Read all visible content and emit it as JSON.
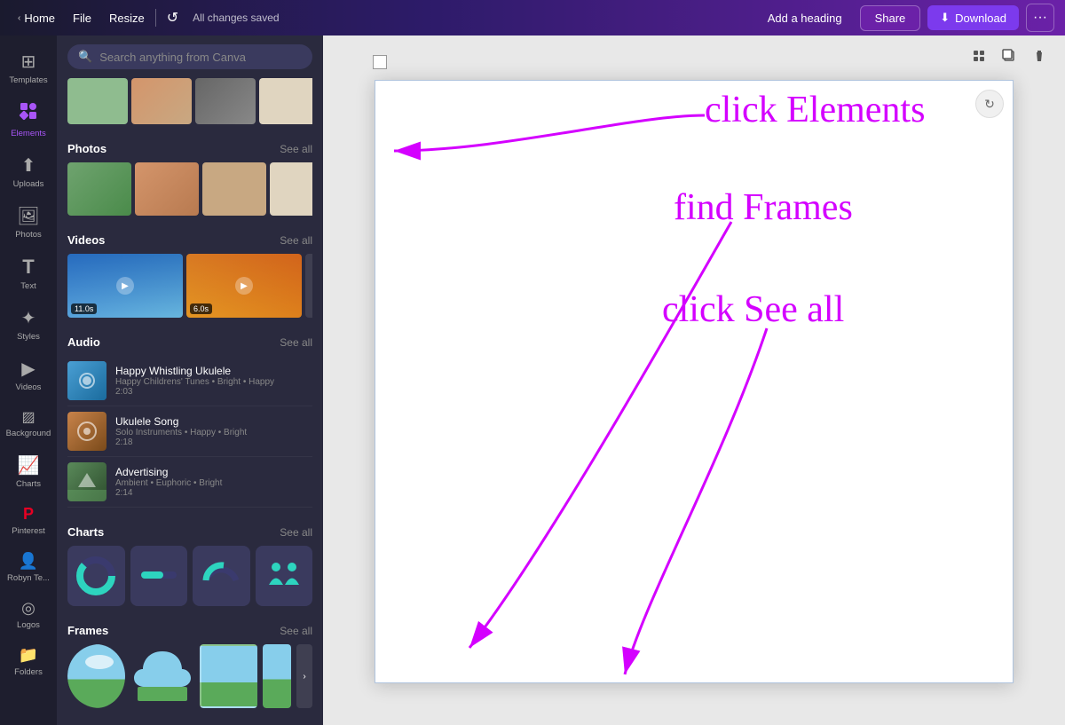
{
  "topbar": {
    "home_label": "Home",
    "file_label": "File",
    "resize_label": "Resize",
    "saved_label": "All changes saved",
    "add_heading_label": "Add a heading",
    "share_label": "Share",
    "download_label": "Download"
  },
  "sidebar": {
    "items": [
      {
        "id": "templates",
        "label": "Templates",
        "icon": "⊞"
      },
      {
        "id": "elements",
        "label": "Elements",
        "icon": "❋"
      },
      {
        "id": "uploads",
        "label": "Uploads",
        "icon": "↑"
      },
      {
        "id": "photos",
        "label": "Photos",
        "icon": "🖼"
      },
      {
        "id": "text",
        "label": "Text",
        "icon": "T"
      },
      {
        "id": "styles",
        "label": "Styles",
        "icon": "✦"
      },
      {
        "id": "videos",
        "label": "Videos",
        "icon": "▶"
      },
      {
        "id": "background",
        "label": "Background",
        "icon": "▨"
      },
      {
        "id": "charts",
        "label": "Charts",
        "icon": "📈"
      },
      {
        "id": "pinterest",
        "label": "Pinterest",
        "icon": "𝐏"
      },
      {
        "id": "robyn",
        "label": "Robyn Te...",
        "icon": "👤"
      },
      {
        "id": "logos",
        "label": "Logos",
        "icon": "◎"
      },
      {
        "id": "folders",
        "label": "Folders",
        "icon": "📁"
      }
    ]
  },
  "panel": {
    "search_placeholder": "Search anything from Canva",
    "sections": {
      "photos": {
        "title": "Photos",
        "see_all": "See all"
      },
      "videos": {
        "title": "Videos",
        "see_all": "See all",
        "items": [
          {
            "duration": "11.0s"
          },
          {
            "duration": "6.0s"
          }
        ]
      },
      "audio": {
        "title": "Audio",
        "see_all": "See all",
        "items": [
          {
            "title": "Happy Whistling Ukulele",
            "meta": "Happy Childrens' Tunes • Bright • Happy",
            "duration": "2:03"
          },
          {
            "title": "Ukulele Song",
            "meta": "Solo Instruments • Happy • Bright",
            "duration": "2:18"
          },
          {
            "title": "Advertising",
            "meta": "Ambient • Euphoric • Bright",
            "duration": "2:14"
          }
        ]
      },
      "charts": {
        "title": "Charts",
        "see_all": "See all"
      },
      "frames": {
        "title": "Frames",
        "see_all": "See all"
      }
    }
  },
  "annotations": {
    "click_elements": "click Elements",
    "find_frames": "find Frames",
    "click_see_all": "click See all"
  },
  "canvas": {
    "refresh_icon": "↻"
  }
}
